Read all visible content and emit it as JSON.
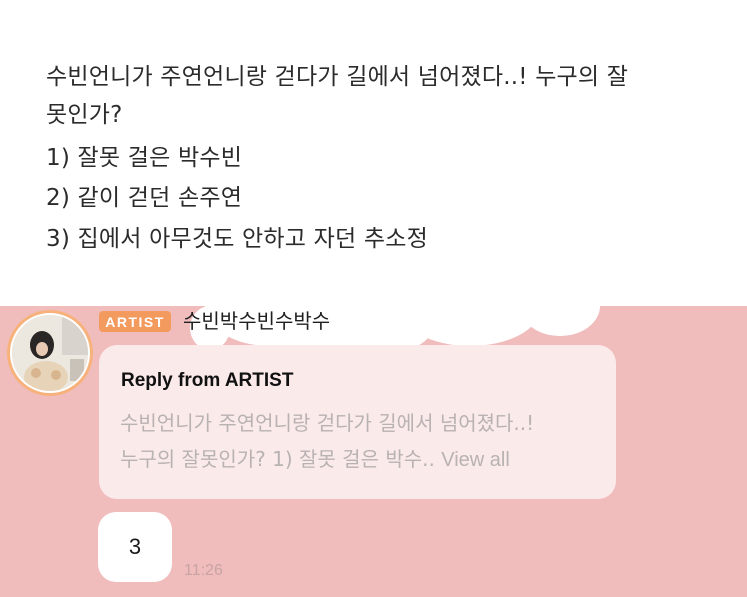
{
  "post": {
    "lines": [
      "수빈언니가 주연언니랑 걷다가 길에서 넘어졌다..! 누구의 잘",
      "못인가?",
      "1) 잘못 걸은 박수빈",
      "2) 같이 걷던 손주연",
      "3) 집에서 아무것도 안하고 자던 추소정"
    ]
  },
  "chat": {
    "badge": "ARTIST",
    "sender_name": "수빈박수빈수박수",
    "avatar_icon": "artist-avatar-photo",
    "reply": {
      "title": "Reply from ARTIST",
      "preview_line1": "수빈언니가 주연언니랑 걷다가 길에서 넘어졌다..!",
      "preview_line2": "누구의 잘못인가? 1) 잘못 걸은 박수..",
      "view_all": "View all"
    },
    "message": "3",
    "time": "11:26"
  },
  "colors": {
    "chat_background": "#f0bcbc",
    "badge": "#f39a5f",
    "avatar_ring": "#f7b27c",
    "reply_card": "#fbeaea"
  }
}
